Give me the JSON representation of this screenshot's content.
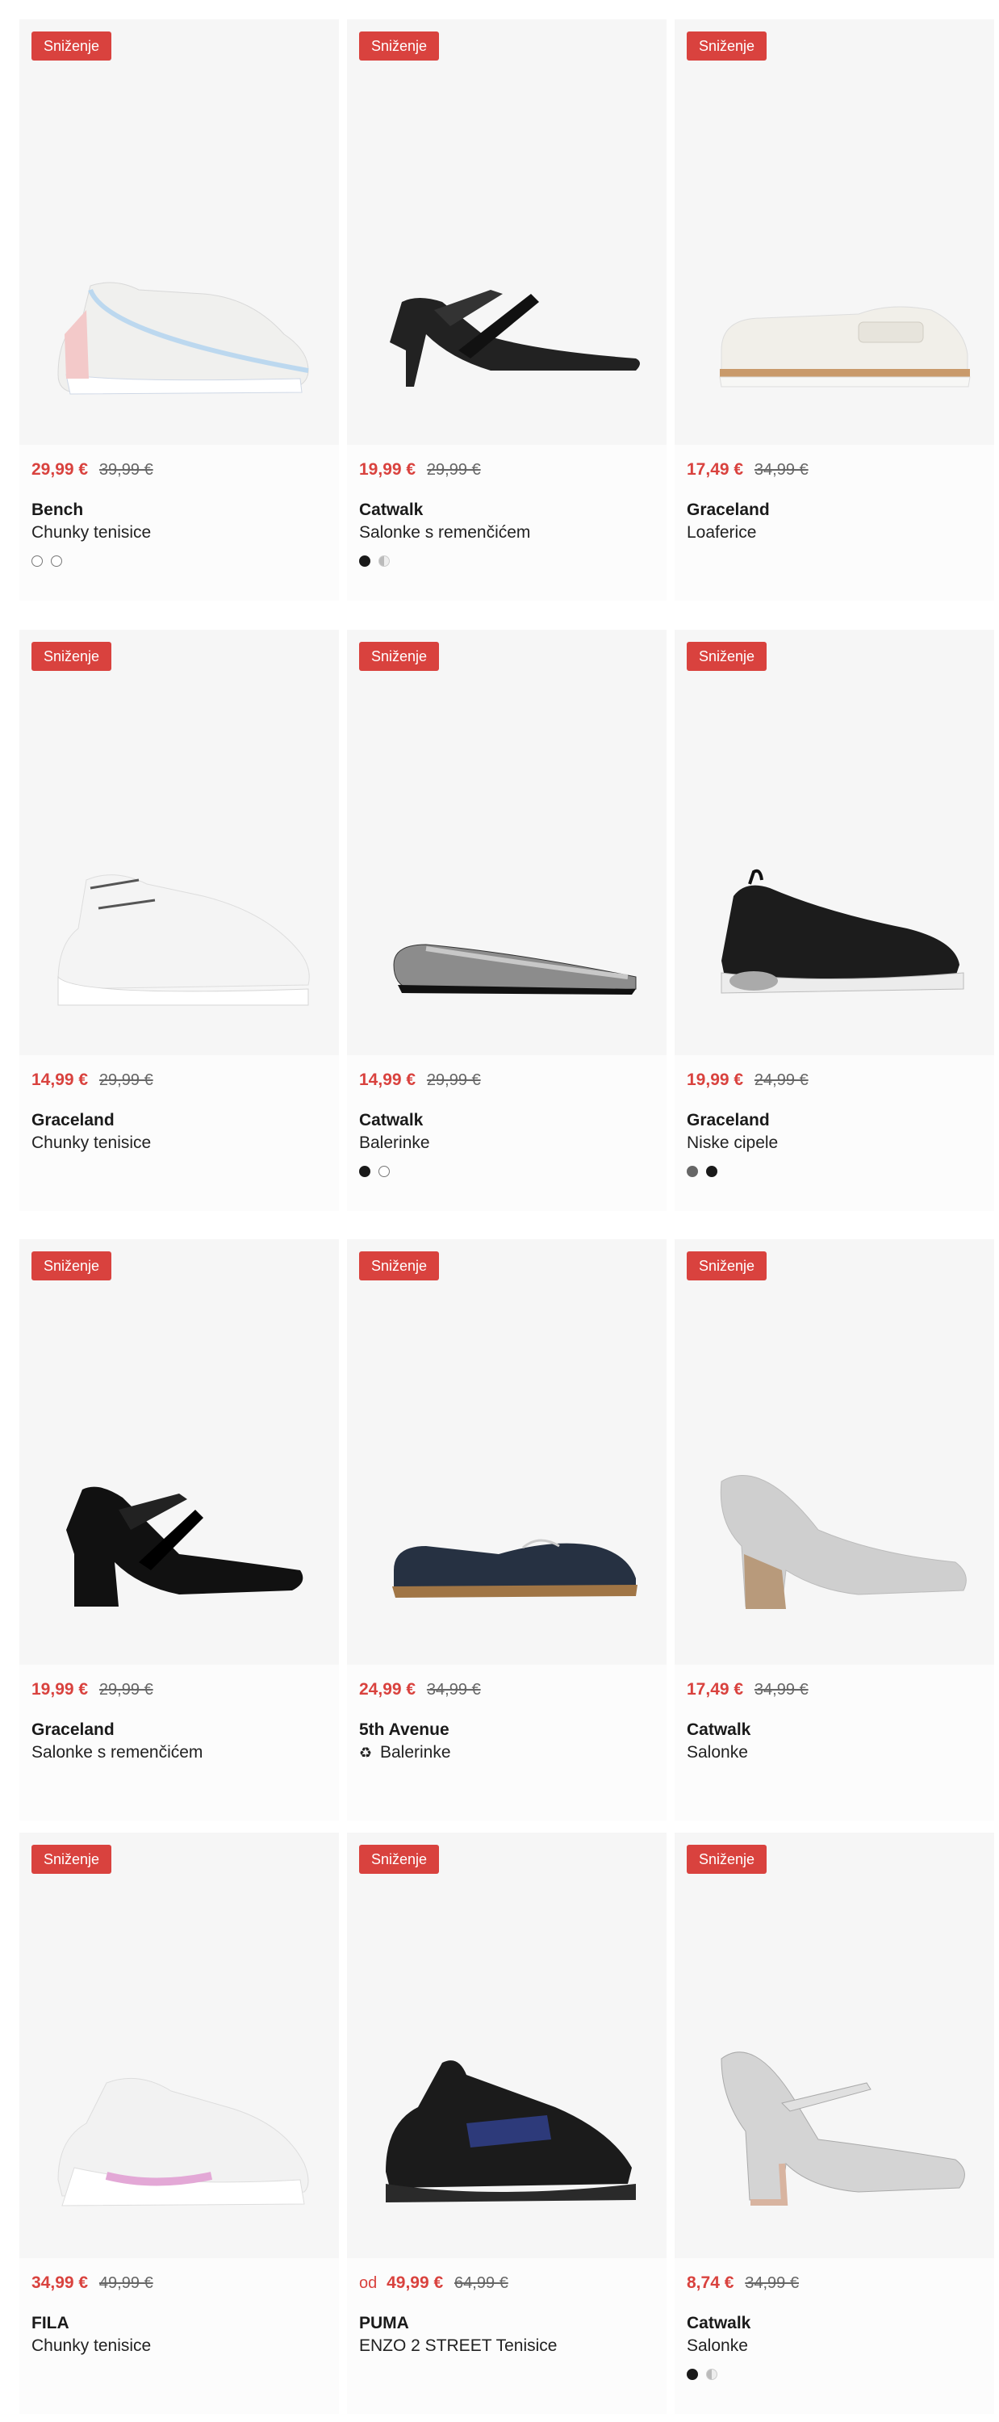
{
  "badge_label": "Sniženje",
  "products": [
    {
      "price": "29,99 €",
      "old_price": "39,99 €",
      "brand": "Bench",
      "name": "Chunky tenisice",
      "colors": [
        "white",
        "white"
      ],
      "icon": "chunky-sneaker-icon"
    },
    {
      "price": "19,99 €",
      "old_price": "29,99 €",
      "brand": "Catwalk",
      "name": "Salonke s remenčićem",
      "colors": [
        "dark",
        "half"
      ],
      "icon": "strappy-heel-icon"
    },
    {
      "price": "17,49 €",
      "old_price": "34,99 €",
      "brand": "Graceland",
      "name": "Loaferice",
      "colors": [],
      "icon": "loafer-icon"
    },
    {
      "price": "14,99 €",
      "old_price": "29,99 €",
      "brand": "Graceland",
      "name": "Chunky tenisice",
      "colors": [],
      "icon": "chunky-sneaker-icon"
    },
    {
      "price": "14,99 €",
      "old_price": "29,99 €",
      "brand": "Catwalk",
      "name": "Balerinke",
      "colors": [
        "dark",
        "white"
      ],
      "icon": "ballerina-flat-icon"
    },
    {
      "price": "19,99 €",
      "old_price": "24,99 €",
      "brand": "Graceland",
      "name": "Niske cipele",
      "colors": [
        "grey",
        "dark"
      ],
      "icon": "slip-on-sneaker-icon"
    },
    {
      "price": "19,99 €",
      "old_price": "29,99 €",
      "brand": "Graceland",
      "name": "Salonke s remenčićem",
      "colors": [],
      "icon": "block-heel-icon"
    },
    {
      "price": "24,99 €",
      "old_price": "34,99 €",
      "brand": "5th Avenue",
      "name": "Balerinke",
      "eco": "♻",
      "colors": [],
      "icon": "loafer-flat-icon"
    },
    {
      "price": "17,49 €",
      "old_price": "34,99 €",
      "brand": "Catwalk",
      "name": "Salonke",
      "colors": [],
      "icon": "platform-pump-icon"
    },
    {
      "price": "34,99 €",
      "old_price": "49,99 €",
      "brand": "FILA",
      "name": "Chunky tenisice",
      "colors": [],
      "icon": "chunky-sneaker-icon"
    },
    {
      "prefix": "od",
      "price": "49,99 €",
      "old_price": "64,99 €",
      "brand": "PUMA",
      "name": "ENZO 2 STREET Tenisice",
      "colors": [],
      "icon": "running-sneaker-icon"
    },
    {
      "price": "8,74 €",
      "old_price": "34,99 €",
      "brand": "Catwalk",
      "name": "Salonke",
      "colors": [
        "dark",
        "half"
      ],
      "icon": "glitter-heel-icon"
    }
  ]
}
